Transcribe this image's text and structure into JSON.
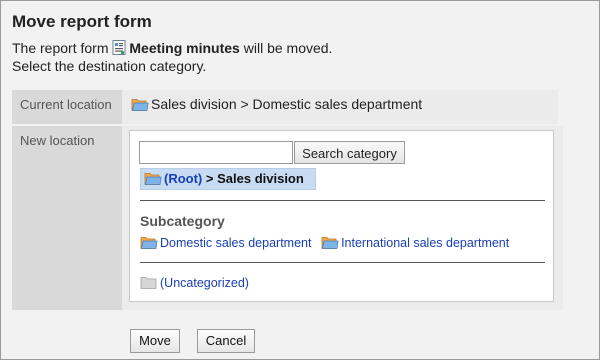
{
  "dialog": {
    "title": "Move report form",
    "description_prefix": "The report form",
    "form_name": "Meeting minutes",
    "description_suffix": "will be moved.",
    "description_line2": "Select the destination category."
  },
  "current_location": {
    "label": "Current location",
    "value": "Sales division > Domestic sales department"
  },
  "new_location": {
    "label": "New location",
    "search": {
      "value": "",
      "placeholder": "",
      "button_label": "Search category"
    },
    "path": {
      "root": "(Root)",
      "separator": ">",
      "current": "Sales division"
    },
    "subcategory_title": "Subcategory",
    "subcategories": [
      "Domestic sales department",
      "International sales department"
    ],
    "uncategorized": "(Uncategorized)"
  },
  "buttons": {
    "move": "Move",
    "cancel": "Cancel"
  },
  "colors": {
    "link": "#1a3fb2",
    "label_background": "#d9d9d9",
    "selected_background": "#c7dbf2"
  }
}
